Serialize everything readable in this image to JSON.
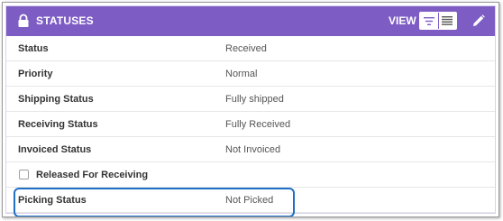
{
  "header": {
    "title": "STATUSES",
    "view_label": "VIEW",
    "background_color": "#7d5cc4"
  },
  "icons": {
    "lock": "lock-icon",
    "list_view_compact": "filter-lines-icon",
    "list_view_full": "list-lines-icon",
    "edit": "pencil-icon"
  },
  "fields": [
    {
      "label": "Status",
      "value": "Received"
    },
    {
      "label": "Priority",
      "value": "Normal"
    },
    {
      "label": "Shipping Status",
      "value": "Fully shipped"
    },
    {
      "label": "Receiving Status",
      "value": "Fully Received"
    },
    {
      "label": "Invoiced Status",
      "value": "Not Invoiced"
    }
  ],
  "checkbox_field": {
    "label": "Released For Receiving",
    "checked": false
  },
  "picking": {
    "label": "Picking Status",
    "value": "Not Picked"
  },
  "highlight_color": "#1f6fc5"
}
